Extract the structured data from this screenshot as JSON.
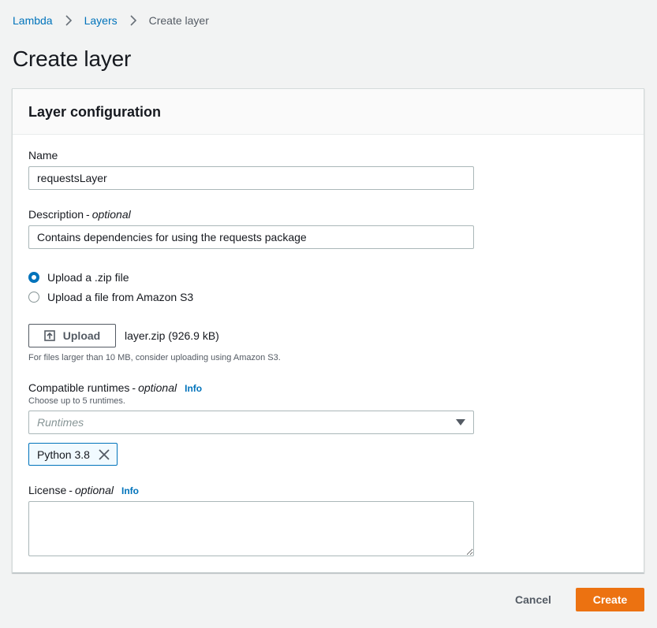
{
  "breadcrumb": {
    "items": [
      "Lambda",
      "Layers"
    ],
    "current": "Create layer"
  },
  "page": {
    "title": "Create layer"
  },
  "panel": {
    "title": "Layer configuration"
  },
  "form": {
    "name": {
      "label": "Name",
      "value": "requestsLayer"
    },
    "description": {
      "label": "Description",
      "optional": "optional",
      "value": "Contains dependencies for using the requests package"
    },
    "source": {
      "options": [
        "Upload a .zip file",
        "Upload a file from Amazon S3"
      ],
      "selected_index": 0
    },
    "upload": {
      "button_label": "Upload",
      "file_name": "layer.zip (926.9 kB)",
      "hint": "For files larger than 10 MB, consider uploading using Amazon S3."
    },
    "runtimes": {
      "label": "Compatible runtimes",
      "optional": "optional",
      "info": "Info",
      "hint": "Choose up to 5 runtimes.",
      "placeholder": "Runtimes",
      "selected": [
        "Python 3.8"
      ]
    },
    "license": {
      "label": "License",
      "optional": "optional",
      "info": "Info",
      "value": ""
    }
  },
  "actions": {
    "cancel_label": "Cancel",
    "create_label": "Create"
  },
  "colors": {
    "accent": "#0073bb",
    "primary_button": "#ec7211",
    "background": "#f2f3f3"
  },
  "icons": {
    "separator": "chevron-right-icon",
    "upload": "upload-icon",
    "dropdown": "caret-down-icon",
    "dismiss": "close-icon"
  }
}
